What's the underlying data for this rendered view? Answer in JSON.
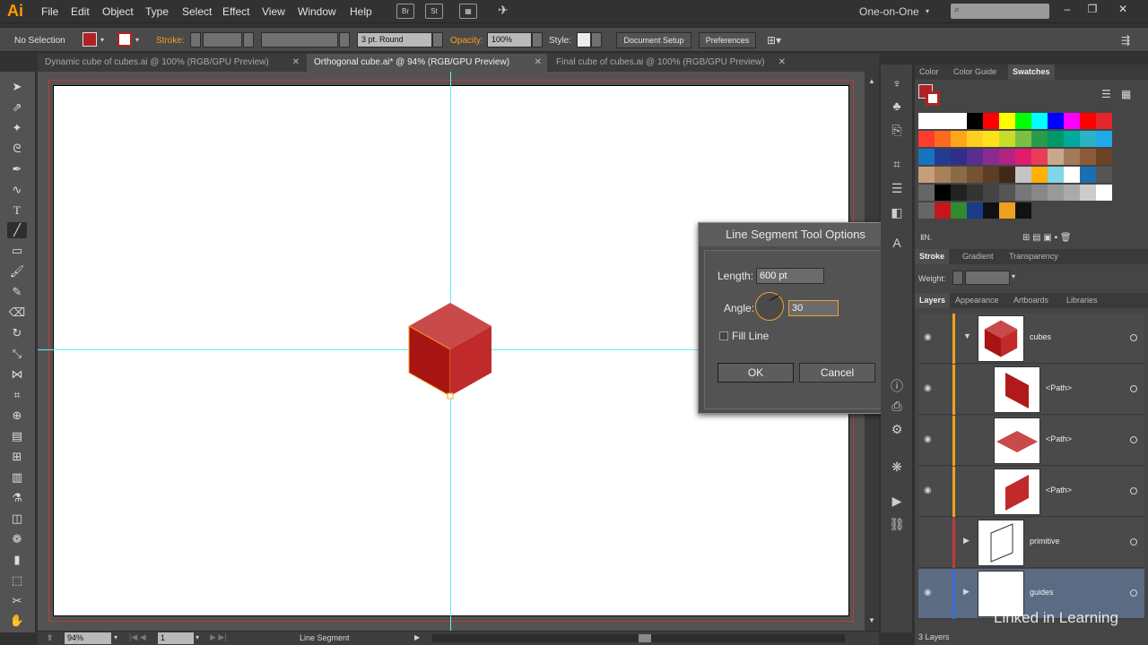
{
  "app": {
    "logo": "Ai",
    "workspace": "One-on-One"
  },
  "menu": [
    "File",
    "Edit",
    "Object",
    "Type",
    "Select",
    "Effect",
    "View",
    "Window",
    "Help"
  ],
  "top_icons": [
    "Br",
    "St"
  ],
  "control": {
    "selection": "No Selection",
    "stroke_label": "Stroke:",
    "stroke_profile": "3 pt. Round",
    "opacity_label": "Opacity:",
    "opacity_value": "100%",
    "style_label": "Style:",
    "document_setup": "Document Setup",
    "preferences": "Preferences"
  },
  "tabs": [
    {
      "label": "Dynamic cube of cubes.ai @ 100% (RGB/GPU Preview)",
      "active": false
    },
    {
      "label": "Orthogonal cube.ai* @ 94% (RGB/GPU Preview)",
      "active": true
    },
    {
      "label": "Final cube of cubes.ai @ 100% (RGB/GPU Preview)",
      "active": false
    }
  ],
  "dialog": {
    "title": "Line Segment Tool Options",
    "length_label": "Length:",
    "length_value": "600 pt",
    "angle_label": "Angle:",
    "angle_value": "30",
    "fill_line_label": "Fill Line",
    "ok": "OK",
    "cancel": "Cancel"
  },
  "swatch_panel": {
    "tabs": [
      "Color",
      "Color Guide",
      "Swatches"
    ]
  },
  "stroke_panel": {
    "tabs": [
      "Stroke",
      "Gradient",
      "Transparency"
    ],
    "weight_label": "Weight:"
  },
  "layers_panel": {
    "tabs": [
      "Layers",
      "Appearance",
      "Artboards",
      "Libraries"
    ],
    "rows": [
      {
        "name": "cubes",
        "expanded": true
      },
      {
        "name": "<Path>"
      },
      {
        "name": "<Path>"
      },
      {
        "name": "<Path>"
      },
      {
        "name": "primitive"
      },
      {
        "name": "guides"
      }
    ],
    "footer": "3 Layers"
  },
  "status": {
    "zoom": "94%",
    "page": "1",
    "tool": "Line Segment"
  },
  "watermark": "Linked in Learning",
  "colors": {
    "accent": "#f6a01a",
    "cube_red": "#b01a1a",
    "guide": "#5ef1f5"
  }
}
